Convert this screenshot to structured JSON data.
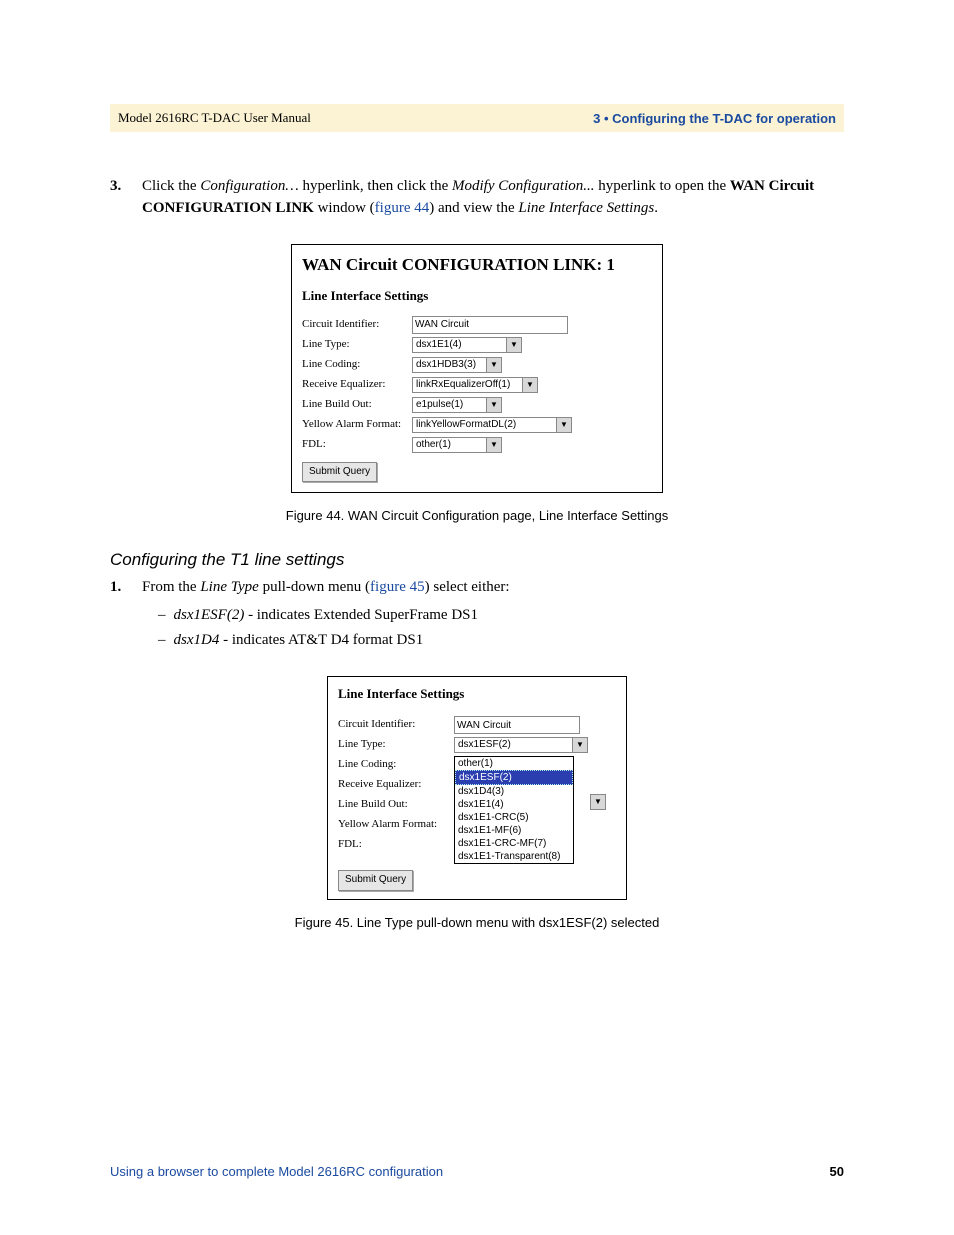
{
  "header": {
    "left": "Model 2616RC T-DAC User Manual",
    "right": "3 • Configuring the T-DAC for operation"
  },
  "step3": {
    "num": "3.",
    "t1": "Click the ",
    "link1": "Configuration…",
    "t2": " hyperlink, then click the ",
    "link2": "Modify Configuration...",
    "t3": " hyperlink to open the ",
    "bold1": "WAN Circuit CONFIGURATION LINK",
    "t4": " window (",
    "figref": "figure 44",
    "t5": ") and view the ",
    "ital1": "Line Interface Settings",
    "t6": "."
  },
  "fig44": {
    "title": "WAN Circuit CONFIGURATION LINK: 1",
    "subtitle": "Line Interface Settings",
    "rows": {
      "circuit_id_label": "Circuit Identifier:",
      "circuit_id_value": "WAN Circuit",
      "line_type_label": "Line Type:",
      "line_type_value": "dsx1E1(4)",
      "line_coding_label": "Line Coding:",
      "line_coding_value": "dsx1HDB3(3)",
      "recv_eq_label": "Receive Equalizer:",
      "recv_eq_value": "linkRxEqualizerOff(1)",
      "lbo_label": "Line Build Out:",
      "lbo_value": "e1pulse(1)",
      "yaf_label": "Yellow Alarm Format:",
      "yaf_value": "linkYellowFormatDL(2)",
      "fdl_label": "FDL:",
      "fdl_value": "other(1)"
    },
    "submit": "Submit Query",
    "caption": "Figure 44. WAN Circuit Configuration page, Line Interface Settings"
  },
  "t1_section": {
    "heading": "Configuring the T1 line settings",
    "step1_num": "1.",
    "step1_a": "From the ",
    "step1_ital": "Line Type",
    "step1_b": " pull-down menu (",
    "step1_ref": "figure 45",
    "step1_c": ") select either:",
    "bullet1_term": "dsx1ESF(2)",
    "bullet1_desc": " - indicates Extended SuperFrame DS1",
    "bullet2_term": "dsx1D4",
    "bullet2_desc": " - indicates AT&T D4 format DS1"
  },
  "fig45": {
    "subtitle": "Line Interface Settings",
    "rows": {
      "circuit_id_label": "Circuit Identifier:",
      "circuit_id_value": "WAN Circuit",
      "line_type_label": "Line Type:",
      "line_type_value": "dsx1ESF(2)",
      "line_coding_label": "Line Coding:",
      "recv_eq_label": "Receive Equalizer:",
      "lbo_label": "Line Build Out:",
      "yaf_label": "Yellow Alarm Format:",
      "fdl_label": "FDL:"
    },
    "dropdown_options": [
      "other(1)",
      "dsx1ESF(2)",
      "dsx1D4(3)",
      "dsx1E1(4)",
      "dsx1E1-CRC(5)",
      "dsx1E1-MF(6)",
      "dsx1E1-CRC-MF(7)",
      "dsx1E1-Transparent(8)"
    ],
    "submit": "Submit Query",
    "caption": "Figure 45. Line Type pull-down menu with dsx1ESF(2) selected"
  },
  "footer": {
    "left": "Using a browser to complete Model 2616RC configuration",
    "page": "50"
  }
}
